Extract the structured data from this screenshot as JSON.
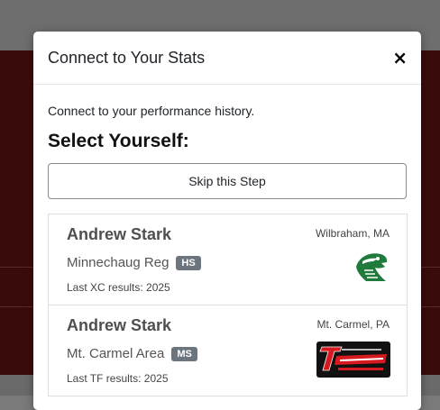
{
  "modal": {
    "title": "Connect to Your Stats",
    "close_label": "×",
    "intro": "Connect to your performance history.",
    "heading": "Select Yourself:",
    "skip_label": "Skip this Step"
  },
  "results": [
    {
      "name": "Andrew Stark",
      "school": "Minnechaug Reg",
      "level": "HS",
      "last_results": "Last XC results: 2025",
      "location": "Wilbraham, MA",
      "logo_icon": "falcon-head-icon",
      "logo_color": "#1f7a3c"
    },
    {
      "name": "Andrew Stark",
      "school": "Mt. Carmel Area",
      "level": "MS",
      "last_results": "Last TF results: 2025",
      "location": "Mt. Carmel, PA",
      "logo_icon": "tornadoes-logo-icon",
      "logo_color": "#d71920"
    }
  ]
}
